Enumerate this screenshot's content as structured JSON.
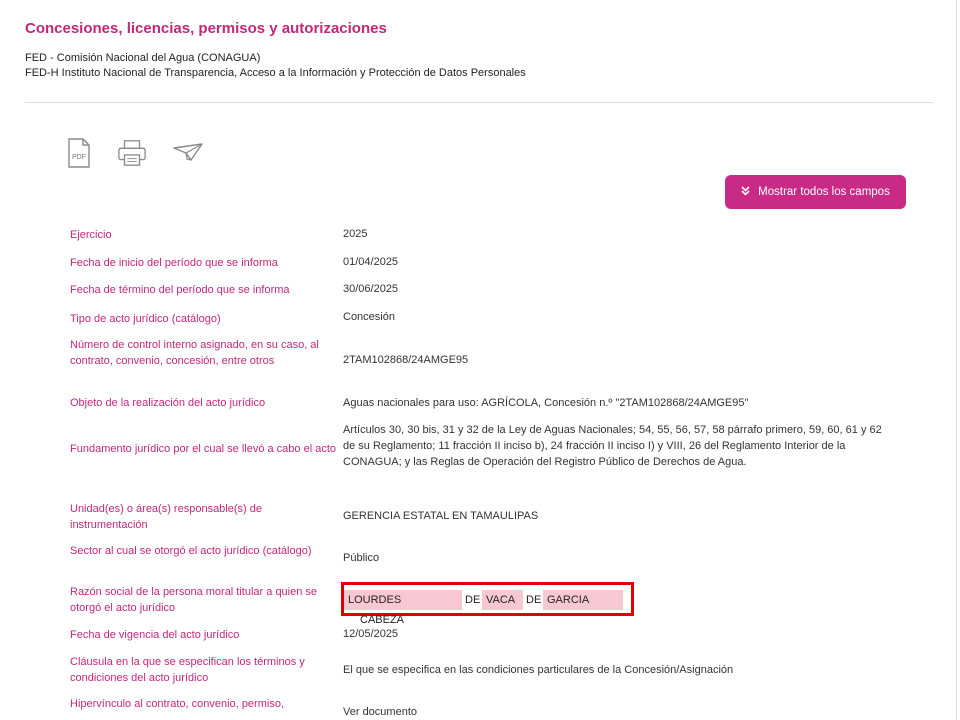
{
  "header": {
    "title": "Concesiones, licencias, permisos y autorizaciones",
    "subtitle_1": "FED - Comisión Nacional del Agua (CONAGUA)",
    "subtitle_2": "FED-H Instituto Nacional de Transparencia, Acceso a la Información y Protección de Datos Personales"
  },
  "toolbar": {
    "pdf_icon": "pdf-file-icon",
    "print_icon": "printer-icon",
    "send_icon": "paper-plane-icon",
    "pdf_label": "PDF",
    "show_all_label": "Mostrar todos los campos"
  },
  "fields": [
    {
      "label": "Ejercicio",
      "value": "2025"
    },
    {
      "label": "Fecha de inicio del período que se informa",
      "value": "01/04/2025"
    },
    {
      "label": "Fecha de término del período que se informa",
      "value": "30/06/2025"
    },
    {
      "label": "Tipo de acto jurídico (catálogo)",
      "value": "Concesión"
    },
    {
      "label": "Número de control interno asignado, en su caso, al contrato, convenio, concesión, entre otros",
      "value": "2TAM102868/24AMGE95"
    },
    {
      "label": "Objeto de la realización del acto jurídico",
      "value": "Aguas nacionales para uso: AGRÍCOLA, Concesión n.º \"2TAM102868/24AMGE95\""
    },
    {
      "label": "Fundamento jurídico por el cual se llevó a cabo el acto",
      "value": "Artículos 30, 30 bis, 31 y 32 de la Ley de Aguas Nacionales; 54, 55, 56, 57, 58 párrafo primero, 59, 60, 61 y 62 de su Reglamento; 11 fracción II inciso b), 24 fracción II inciso I) y VIII, 26 del Reglamento Interior de la CONAGUA; y las Reglas de Operación del Registro Público de Derechos de Agua."
    },
    {
      "label": "Unidad(es) o área(s) responsable(s) de instrumentación",
      "value": "GERENCIA ESTATAL EN TAMAULIPAS"
    },
    {
      "label": "Sector al cual se otorgó el acto jurídico (catálogo)",
      "value": "Público"
    },
    {
      "label": "Razón social de la persona moral titular a quien se otorgó el acto jurídico",
      "value": ""
    },
    {
      "label": "Fecha de vigencia del acto jurídico",
      "value": "12/05/2025"
    },
    {
      "label": "Cláusula en la que se especifican los términos y condiciones del acto jurídico",
      "value": "El que se especifica en las condiciones particulares de la Concesión/Asignación"
    },
    {
      "label": "Hipervínculo al contrato, convenio, permiso,",
      "value": "Ver documento"
    }
  ],
  "razon_social_parts": [
    "LOURDES",
    "CABEZA",
    "DE",
    "VACA",
    "DE",
    "GARCIA"
  ],
  "colors": {
    "accent": "#c2277a",
    "button": "#c92a86",
    "highlight_border": "#e00000",
    "chip": "#f7c8d4"
  }
}
